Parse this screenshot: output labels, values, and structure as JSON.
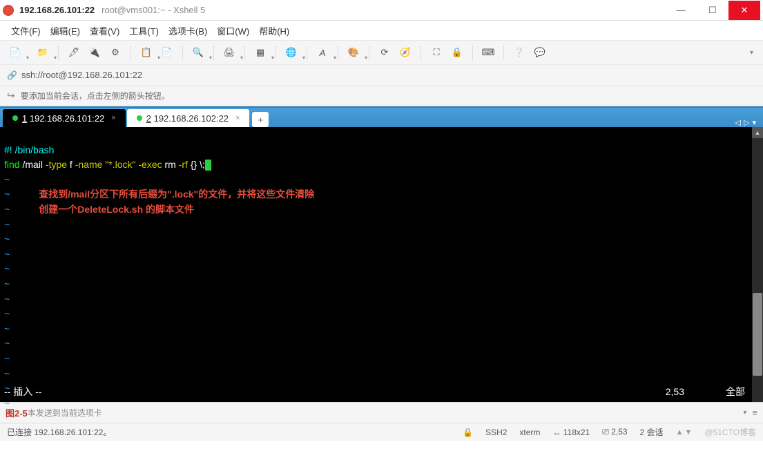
{
  "titlebar": {
    "host": "192.168.26.101:22",
    "subtitle": "root@vms001:~ - Xshell 5"
  },
  "menu": {
    "file": "文件(F)",
    "edit": "编辑(E)",
    "view": "查看(V)",
    "tools": "工具(T)",
    "tabs": "选项卡(B)",
    "window": "窗口(W)",
    "help": "帮助(H)"
  },
  "address": {
    "url": "ssh://root@192.168.26.101:22"
  },
  "infobar": {
    "text": "要添加当前会话，点击左侧的箭头按钮。"
  },
  "tabs": [
    {
      "num": "1",
      "label": "192.168.26.101:22",
      "active": true
    },
    {
      "num": "2",
      "label": "192.168.26.102:22",
      "active": false
    }
  ],
  "terminal": {
    "line1": "#! /bin/bash",
    "line2_find": "find",
    "line2_path": " /mail ",
    "line2_type": "-type",
    "line2_f": " f ",
    "line2_name": "-name ",
    "line2_pattern": "\"*.lock\"",
    "line2_exec": " -exec",
    "line2_rm": " rm ",
    "line2_rf": "-rf",
    "line2_braces": " {} \\;",
    "comment1": "查找到/mail分区下所有后缀为\".lock\"的文件，并将这些文件清除",
    "comment2": "创建一个DeleteLock.sh 的脚本文件",
    "status_mode": "-- 插入 --",
    "status_pos": "2,53",
    "status_pct": "全部"
  },
  "inputbar": {
    "label": "图2-5",
    "hint": "本发送到当前选项卡"
  },
  "statusbar": {
    "connected": "已连接 192.168.26.101:22。",
    "proto": "SSH2",
    "term": "xterm",
    "size": "118x21",
    "pos": "2,53",
    "sessions": "2 会话",
    "watermark": "@51CTO博客"
  }
}
